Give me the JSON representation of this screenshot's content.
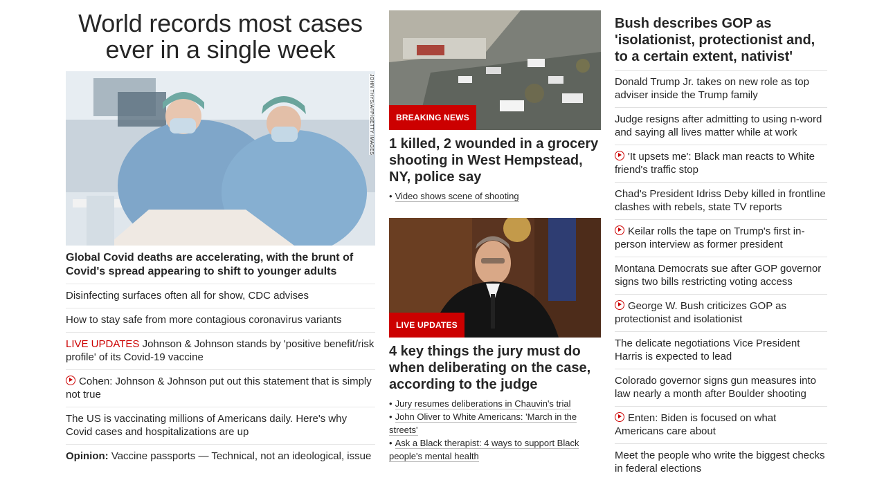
{
  "col1": {
    "headline": "World records most cases ever in a single week",
    "image_credit": "JOHN THYS/AFP/GETTY IMAGES",
    "subhead": "Global Covid deaths are accelerating, with the brunt of Covid's spread appearing to shift to younger adults",
    "items": [
      {
        "text": "Disinfecting surfaces often all for show, CDC advises"
      },
      {
        "text": "How to stay safe from more contagious coronavirus variants"
      },
      {
        "live_label": "LIVE UPDATES",
        "text": "Johnson & Johnson stands by 'positive benefit/risk profile' of its Covid-19 vaccine"
      },
      {
        "text": "Cohen: Johnson & Johnson put out this statement that is simply not true"
      },
      {
        "text": "The US is vaccinating millions of Americans daily. Here's why Covid cases and hospitalizations are up"
      },
      {
        "prefix": "Opinion:",
        "text": "Vaccine passports — Technical, not an ideological, issue"
      }
    ]
  },
  "col2": {
    "card1": {
      "badge": "BREAKING NEWS",
      "title": "1 killed, 2 wounded in a grocery shooting in West Hempstead, NY, police say",
      "bullets": [
        "Video shows scene of shooting"
      ]
    },
    "card2": {
      "badge": "LIVE UPDATES",
      "title": "4 key things the jury must do when deliberating on the case, according to the judge",
      "bullets": [
        "Jury resumes deliberations in Chauvin's trial",
        "John Oliver to White Americans: 'March in the streets'",
        "Ask a Black therapist: 4 ways to support Black people's mental health"
      ]
    }
  },
  "col3": {
    "headline": "Bush describes GOP as 'isolationist, protectionist and, to a certain extent, nativist'",
    "items": [
      {
        "text": "Donald Trump Jr. takes on new role as top adviser inside the Trump family"
      },
      {
        "text": "Judge resigns after admitting to using n-word and saying all lives matter while at work"
      },
      {
        "text": "'It upsets me': Black man reacts to White friend's traffic stop",
        "video": true
      },
      {
        "text": "Chad's President Idriss Deby killed in frontline clashes with rebels, state TV reports"
      },
      {
        "text": "Keilar rolls the tape on Trump's first in-person interview as former president",
        "video": true
      },
      {
        "text": "Montana Democrats sue after GOP governor signs two bills restricting voting access"
      },
      {
        "text": "George W. Bush criticizes GOP as protectionist and isolationist",
        "video": true
      },
      {
        "text": "The delicate negotiations Vice President Harris is expected to lead"
      },
      {
        "text": "Colorado governor signs gun measures into law nearly a month after Boulder shooting"
      },
      {
        "text": "Enten: Biden is focused on what Americans care about",
        "video": true
      },
      {
        "text": "Meet the people who write the biggest checks in federal elections"
      }
    ]
  },
  "colors": {
    "accent": "#cc0000",
    "text": "#262626",
    "divider": "#e6e6e6"
  }
}
